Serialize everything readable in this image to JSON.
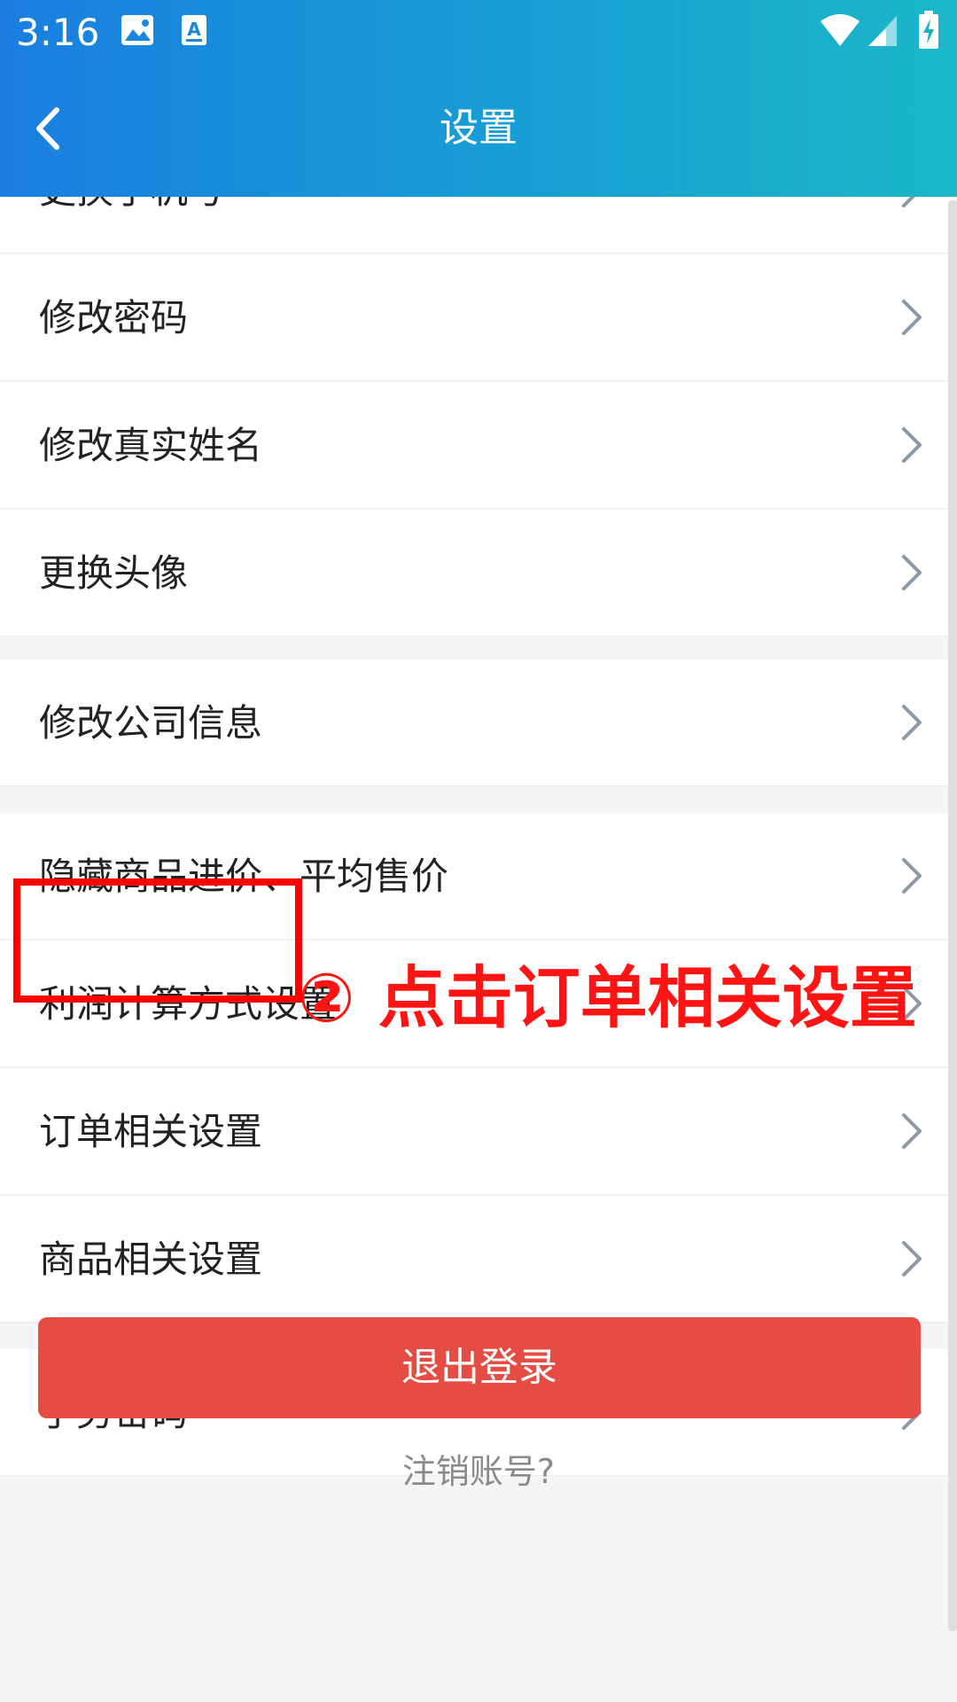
{
  "status_bar": {
    "time": "3:16",
    "icons": [
      "image-icon",
      "font-a-icon",
      "wifi-icon",
      "cell-signal-icon",
      "battery-charging-icon"
    ]
  },
  "toolbar": {
    "title": "设置",
    "back_icon": "chevron-left-icon"
  },
  "settings": {
    "partial_item": {
      "label": "更换手机号"
    },
    "items": [
      {
        "label": "修改密码"
      },
      {
        "label": "修改真实姓名"
      },
      {
        "label": "更换头像"
      },
      {
        "label": "修改公司信息"
      },
      {
        "label": "隐藏商品进价、平均售价"
      },
      {
        "label": "利润计算方式设置"
      },
      {
        "label": "订单相关设置"
      },
      {
        "label": "商品相关设置"
      },
      {
        "label": "手势密码"
      }
    ],
    "arrow_icon": "chevron-right-icon"
  },
  "logout": {
    "label": "退出登录"
  },
  "cancel_account": {
    "label": "注销账号?"
  },
  "annotation": {
    "text": "② 点击订单相关设置",
    "color": "#ff1414"
  },
  "colors": {
    "header_gradient_start": "#1a7ee0",
    "header_gradient_end": "#1bb7c7",
    "logout_button": "#e54d44",
    "page_background": "#f5f5f5"
  }
}
